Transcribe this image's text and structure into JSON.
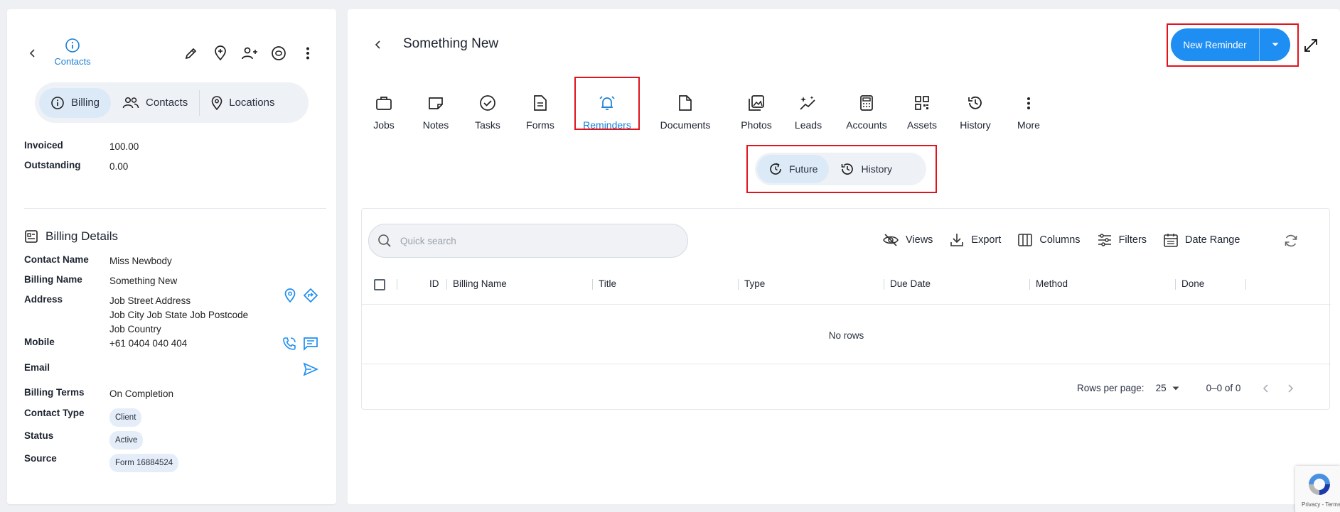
{
  "left_panel": {
    "contacts_label": "Contacts",
    "segments": {
      "billing": "Billing",
      "contacts": "Contacts",
      "locations": "Locations"
    },
    "invoiced_label": "Invoiced",
    "invoiced_value": "100.00",
    "outstanding_label": "Outstanding",
    "outstanding_value": "0.00",
    "billing_details_title": "Billing Details",
    "contact_name_label": "Contact Name",
    "contact_name": "Miss Newbody",
    "billing_name_label": "Billing Name",
    "billing_name": "Something New",
    "address_label": "Address",
    "address_line1": "Job Street Address",
    "address_line2": "Job City Job State Job Postcode",
    "address_line3": "Job Country",
    "mobile_label": "Mobile",
    "mobile": "+61 0404 040 404",
    "email_label": "Email",
    "billing_terms_label": "Billing Terms",
    "billing_terms": "On Completion",
    "contact_type_label": "Contact Type",
    "contact_type": "Client",
    "status_label": "Status",
    "status": "Active",
    "source_label": "Source",
    "source": "Form 16884524"
  },
  "main": {
    "title": "Something New",
    "new_reminder_label": "New Reminder",
    "tabs": [
      "Jobs",
      "Notes",
      "Tasks",
      "Forms",
      "Reminders",
      "Documents",
      "Photos",
      "Leads",
      "Accounts",
      "Assets",
      "History",
      "More"
    ],
    "active_tab": "Reminders",
    "toggle": {
      "future": "Future",
      "history": "History",
      "active": "Future"
    },
    "search_placeholder": "Quick search",
    "toolbar": {
      "views": "Views",
      "export": "Export",
      "columns": "Columns",
      "filters": "Filters",
      "date_range": "Date Range"
    },
    "columns": [
      "ID",
      "Billing Name",
      "Title",
      "Type",
      "Due Date",
      "Method",
      "Done"
    ],
    "empty_text": "No rows",
    "rows_per_page_label": "Rows per page:",
    "rows_per_page": "25",
    "range_text": "0–0 of 0"
  },
  "recaptcha_text": "Privacy - Terms",
  "colors": {
    "accent": "#1e8ef2",
    "highlight": "#e0141c",
    "active_bg": "#dceaf8"
  }
}
